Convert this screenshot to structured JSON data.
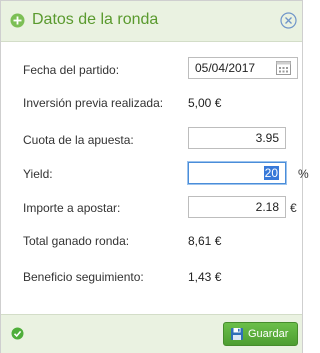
{
  "header": {
    "title": "Datos de la ronda",
    "icon": "circle-plus-icon",
    "close_icon": "close-circle-icon",
    "accent_color": "#5a9a2e"
  },
  "form": {
    "fecha_label": "Fecha del partido:",
    "fecha_value": "05/04/2017",
    "inversion_label": "Inversión previa realizada:",
    "inversion_value": "5,00 €",
    "cuota_label": "Cuota de la apuesta:",
    "cuota_value": "3.95",
    "yield_label": "Yield:",
    "yield_value": "20",
    "yield_suffix": "%",
    "importe_label": "Importe a apostar:",
    "importe_value": "2.18",
    "importe_suffix": "€",
    "total_label": "Total ganado ronda:",
    "total_value": "8,61 €",
    "beneficio_label": "Beneficio seguimiento:",
    "beneficio_value": "1,43 €"
  },
  "footer": {
    "status_icon": "check-circle-icon",
    "save_label": "Guardar",
    "save_icon": "floppy-disk-icon",
    "button_color": "#5aae3b"
  }
}
